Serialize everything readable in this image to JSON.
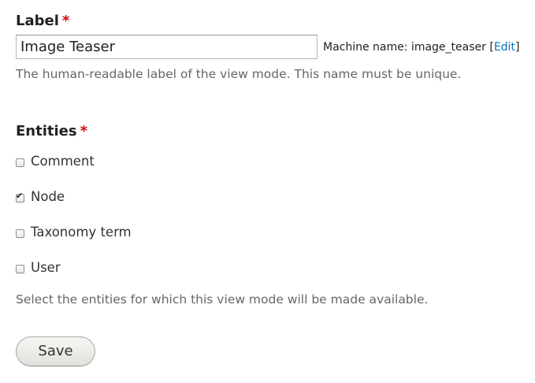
{
  "label_field": {
    "title": "Label",
    "required_marker": "*",
    "value": "Image Teaser",
    "machine_name_prefix": "Machine name: image_teaser",
    "machine_name_open_bracket": "[",
    "machine_name_edit_link": "Edit",
    "machine_name_close_bracket": "]",
    "description": "The human-readable label of the view mode. This name must be unique."
  },
  "entities_field": {
    "title": "Entities",
    "required_marker": "*",
    "options": [
      {
        "label": "Comment",
        "checked": false
      },
      {
        "label": "Node",
        "checked": true
      },
      {
        "label": "Taxonomy term",
        "checked": false
      },
      {
        "label": "User",
        "checked": false
      }
    ],
    "description": "Select the entities for which this view mode will be made available."
  },
  "actions": {
    "save_label": "Save"
  },
  "colors": {
    "required": "#dd0000",
    "link": "#0074bd",
    "description_text": "#666666"
  }
}
